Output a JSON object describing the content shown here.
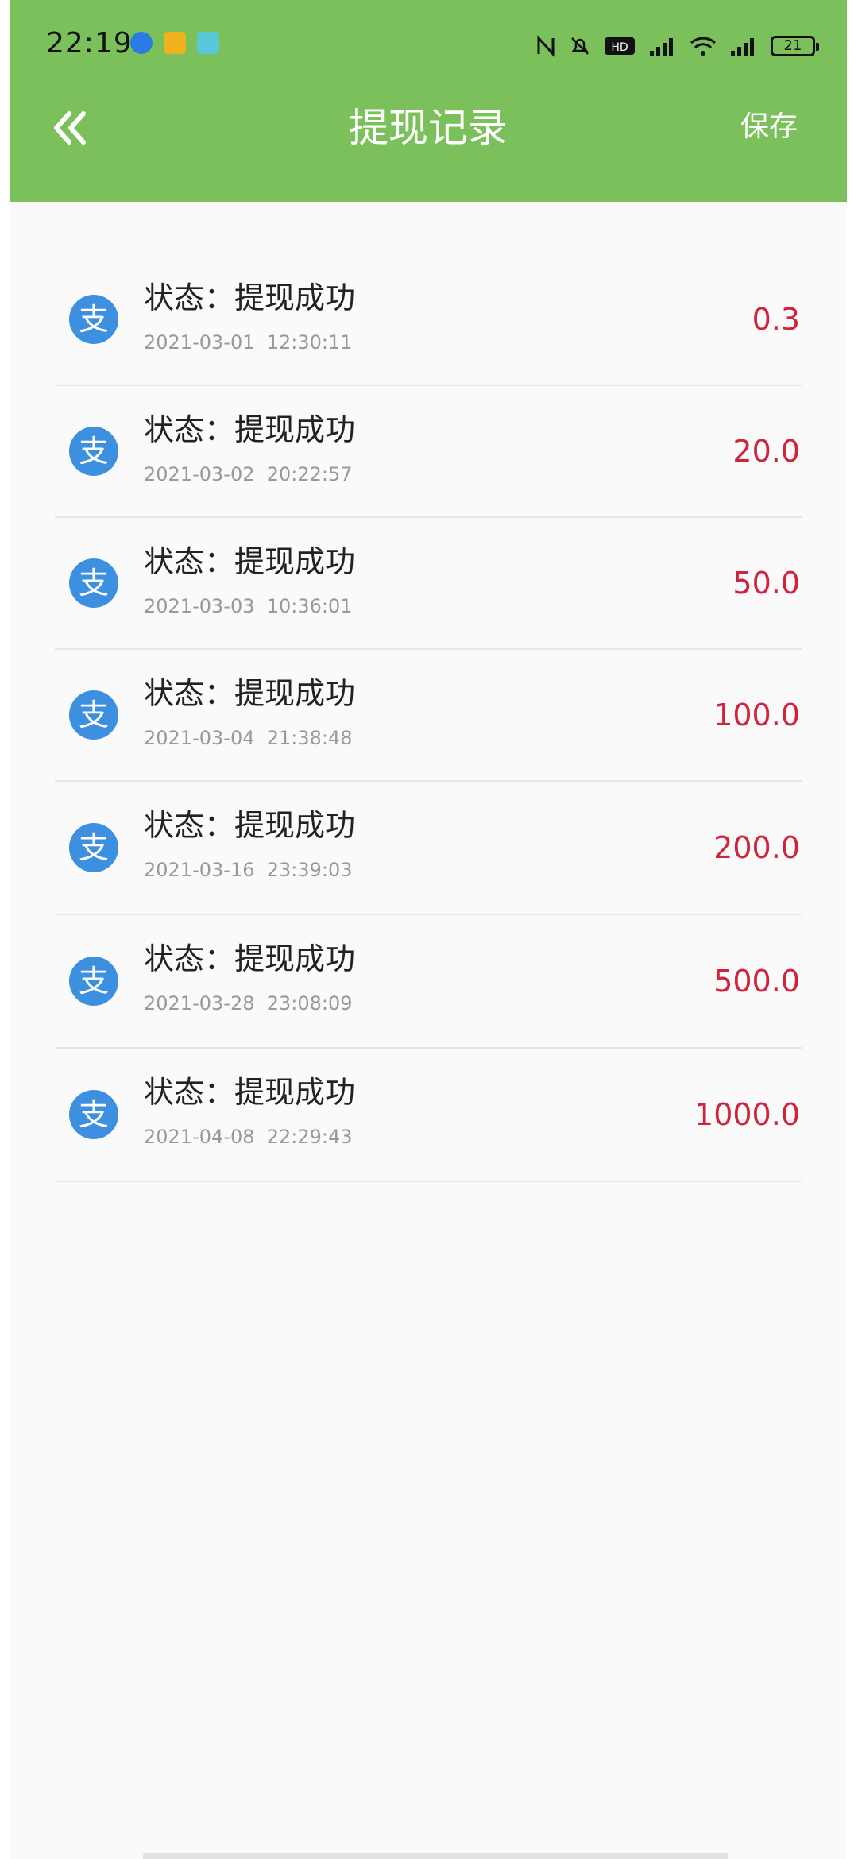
{
  "status_bar": {
    "time": "22:19",
    "battery": "21"
  },
  "header": {
    "title": "提现记录",
    "save_label": "保存"
  },
  "records": [
    {
      "status": "状态：提现成功",
      "time": "2021-03-01  12:30:11",
      "amount": "0.3"
    },
    {
      "status": "状态：提现成功",
      "time": "2021-03-02  20:22:57",
      "amount": "20.0"
    },
    {
      "status": "状态：提现成功",
      "time": "2021-03-03  10:36:01",
      "amount": "50.0"
    },
    {
      "status": "状态：提现成功",
      "time": "2021-03-04  21:38:48",
      "amount": "100.0"
    },
    {
      "status": "状态：提现成功",
      "time": "2021-03-16  23:39:03",
      "amount": "200.0"
    },
    {
      "status": "状态：提现成功",
      "time": "2021-03-28  23:08:09",
      "amount": "500.0"
    },
    {
      "status": "状态：提现成功",
      "time": "2021-04-08  22:29:43",
      "amount": "1000.0"
    }
  ],
  "icons": {
    "record": "alipay-icon",
    "back": "double-chevron-left-icon"
  },
  "colors": {
    "header": "#7bc05a",
    "amount": "#d0243c",
    "alipay": "#3d8fe0"
  }
}
